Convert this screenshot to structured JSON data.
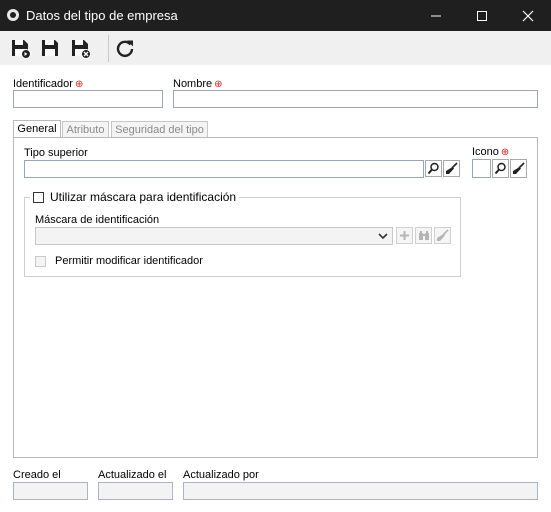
{
  "window": {
    "title": "Datos del tipo de empresa",
    "icon": "app-globe-icon",
    "controls": [
      "minimize-icon",
      "maximize-icon",
      "close-icon"
    ]
  },
  "toolbar": {
    "buttons": [
      {
        "name": "save-and-new-button",
        "icon": "floppy-plus-icon"
      },
      {
        "name": "save-button",
        "icon": "floppy-icon"
      },
      {
        "name": "save-and-close-button",
        "icon": "floppy-close-icon"
      },
      {
        "name": "refresh-button",
        "icon": "refresh-icon"
      }
    ]
  },
  "form": {
    "identificador_label": "Identificador",
    "identificador_value": "",
    "nombre_label": "Nombre",
    "nombre_value": "",
    "required_mark": "⊕"
  },
  "tabs": [
    {
      "label": "General",
      "active": true
    },
    {
      "label": "Atributo",
      "active": false
    },
    {
      "label": "Seguridad del tipo",
      "active": false
    }
  ],
  "general": {
    "tipo_superior_label": "Tipo superior",
    "tipo_superior_value": "",
    "icono_label": "Icono",
    "mask_checkbox_label": "Utilizar máscara para identificación",
    "mask_checked": false,
    "mask_field_label": "Máscara de identificación",
    "mask_value": "",
    "allow_modify_label": "Permitir modificar identificador",
    "allow_modify_checked": false
  },
  "footer": {
    "created_label": "Creado el",
    "created_value": "",
    "updated_label": "Actualizado el",
    "updated_value": "",
    "updated_by_label": "Actualizado por",
    "updated_by_value": ""
  },
  "colors": {
    "titlebar": "#1f1f1f",
    "required": "#e02020",
    "input_border": "#9aa7b8"
  }
}
